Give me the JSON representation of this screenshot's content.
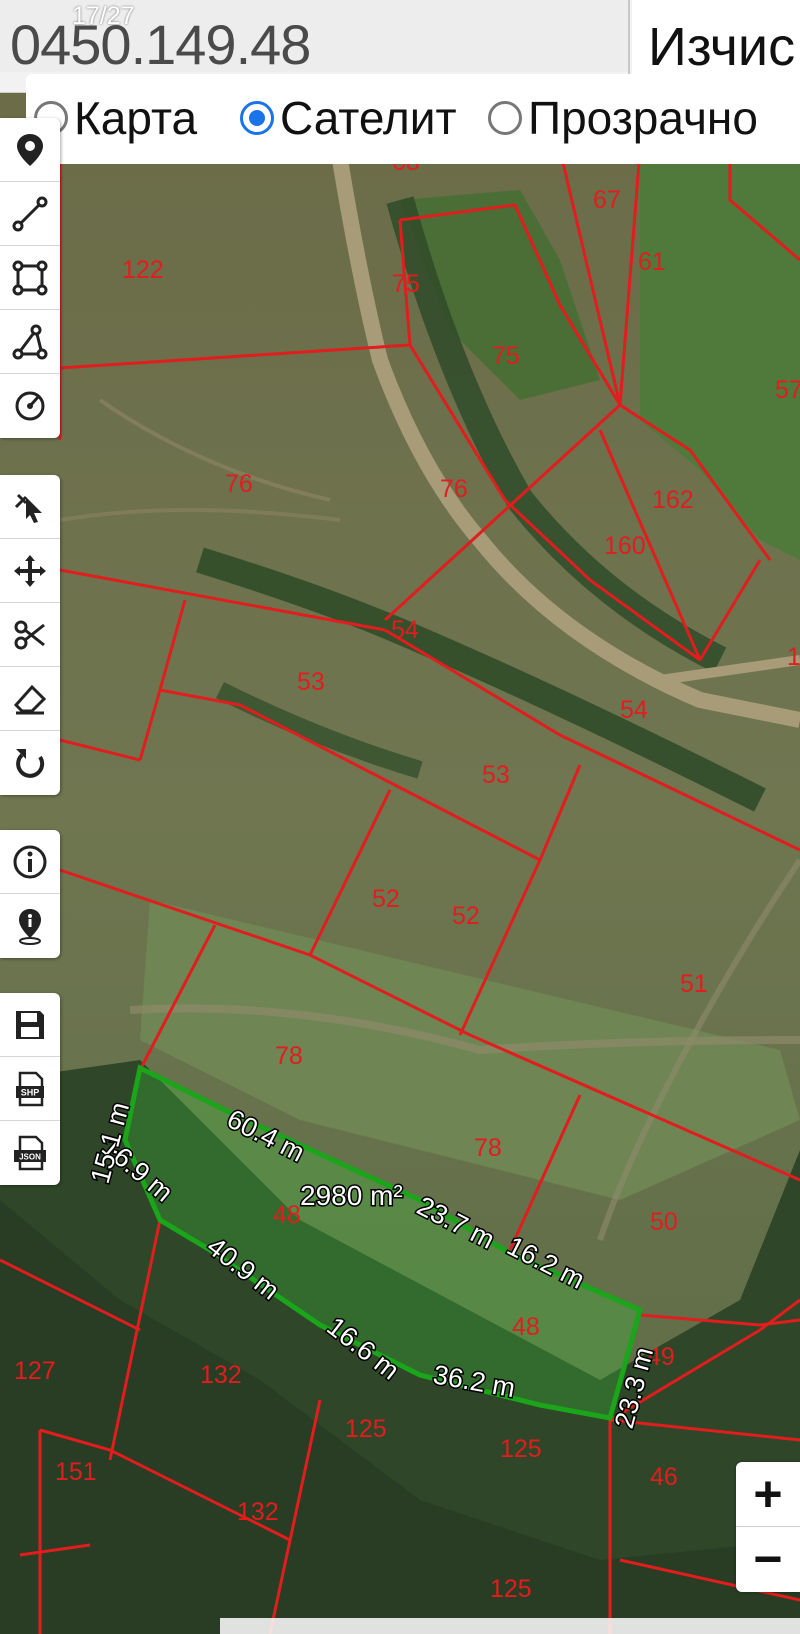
{
  "header": {
    "coordinate": "0450.149.48",
    "page_counter": "17/27",
    "action_label": "Изчис"
  },
  "layers": [
    {
      "label": "Карта",
      "selected": false
    },
    {
      "label": "Сателит",
      "selected": true
    },
    {
      "label": "Прозрачно",
      "selected": false
    }
  ],
  "toolbar_groups": [
    [
      "location-pin-icon",
      "polyline-icon",
      "rectangle-icon",
      "polygon-icon",
      "circle-icon"
    ],
    [
      "pointer-icon",
      "move-icon",
      "scissors-icon",
      "eraser-icon",
      "undo-icon"
    ],
    [
      "info-icon",
      "info-pin-icon"
    ],
    [
      "save-icon",
      "shp-file-icon",
      "json-file-icon"
    ]
  ],
  "file_badges": {
    "shp": "SHP",
    "json": "JSON"
  },
  "map": {
    "parcel_labels": [
      "122",
      "75",
      "75",
      "67",
      "61",
      "57",
      "76",
      "76",
      "162",
      "160",
      "1",
      "54",
      "53",
      "54",
      "53",
      "52",
      "52",
      "51",
      "78",
      "78",
      "50",
      "48",
      "48",
      "49",
      "127",
      "132",
      "125",
      "125",
      "151",
      "132",
      "46",
      "125",
      "68",
      "68"
    ],
    "area_label": "2980 m²",
    "edge_lengths": [
      "60.4 m",
      "23.7 m",
      "16.2 m",
      "23.3 m",
      "36.2 m",
      "16.6 m",
      "40.9 m",
      "16.9 m",
      "15.1 m"
    ],
    "colors": {
      "boundary": "#e11d1d",
      "selection": "#1aa51a"
    }
  },
  "zoom": {
    "in": "+",
    "out": "−"
  }
}
